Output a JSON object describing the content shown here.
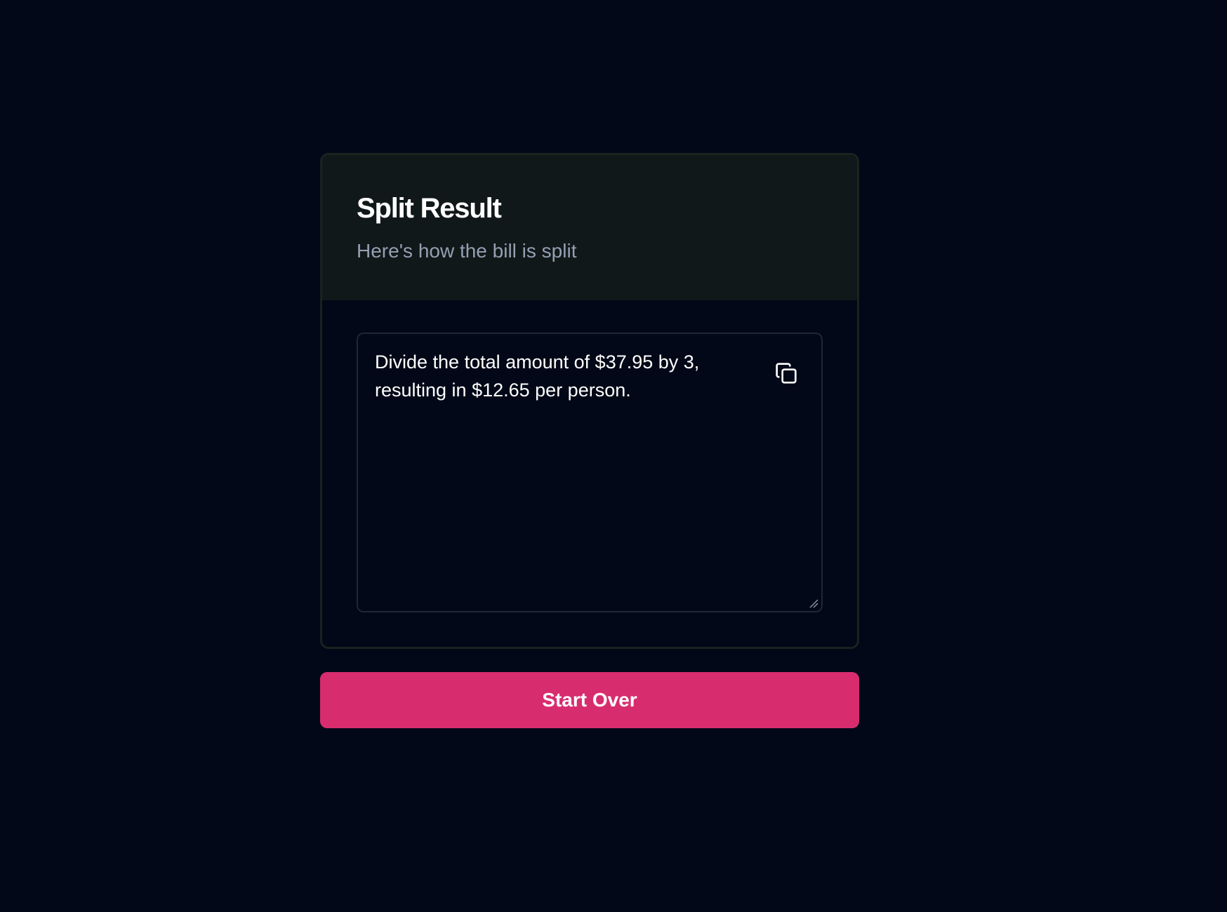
{
  "card": {
    "title": "Split Result",
    "subtitle": "Here's how the bill is split"
  },
  "result": {
    "text": "Divide the total amount of $37.95 by 3,\nresulting in $12.65 per person.",
    "copy_icon": "copy-icon"
  },
  "actions": {
    "start_over_label": "Start Over"
  },
  "colors": {
    "background": "#020817",
    "header_background": "#111819",
    "subtitle": "#94a0b3",
    "accent": "#d72d6f"
  }
}
